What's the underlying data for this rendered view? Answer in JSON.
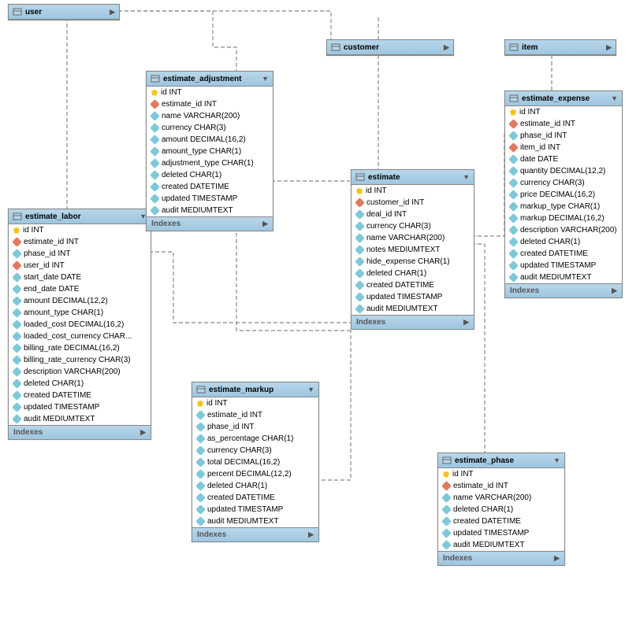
{
  "tables": {
    "user": {
      "title": "user",
      "columns": []
    },
    "customer": {
      "title": "customer",
      "columns": []
    },
    "item": {
      "title": "item",
      "columns": []
    },
    "estimate_labor": {
      "title": "estimate_labor",
      "columns": [
        {
          "kind": "pk",
          "label": "id INT"
        },
        {
          "kind": "fk",
          "label": "estimate_id INT"
        },
        {
          "kind": "fld",
          "label": "phase_id INT"
        },
        {
          "kind": "fk",
          "label": "user_id INT"
        },
        {
          "kind": "fld",
          "label": "start_date DATE"
        },
        {
          "kind": "fld",
          "label": "end_date DATE"
        },
        {
          "kind": "fld",
          "label": "amount DECIMAL(12,2)"
        },
        {
          "kind": "fld",
          "label": "amount_type CHAR(1)"
        },
        {
          "kind": "fld",
          "label": "loaded_cost DECIMAL(16,2)"
        },
        {
          "kind": "fld",
          "label": "loaded_cost_currency CHAR..."
        },
        {
          "kind": "fld",
          "label": "billing_rate DECIMAL(16,2)"
        },
        {
          "kind": "fld",
          "label": "billing_rate_currency CHAR(3)"
        },
        {
          "kind": "fld",
          "label": "description VARCHAR(200)"
        },
        {
          "kind": "fld",
          "label": "deleted CHAR(1)"
        },
        {
          "kind": "fld",
          "label": "created DATETIME"
        },
        {
          "kind": "fld",
          "label": "updated TIMESTAMP"
        },
        {
          "kind": "fld",
          "label": "audit MEDIUMTEXT"
        }
      ],
      "indexes": "Indexes"
    },
    "estimate_adjustment": {
      "title": "estimate_adjustment",
      "columns": [
        {
          "kind": "pk",
          "label": "id INT"
        },
        {
          "kind": "fk",
          "label": "estimate_id INT"
        },
        {
          "kind": "fld",
          "label": "name VARCHAR(200)"
        },
        {
          "kind": "fld",
          "label": "currency CHAR(3)"
        },
        {
          "kind": "fld",
          "label": "amount DECIMAL(16,2)"
        },
        {
          "kind": "fld",
          "label": "amount_type CHAR(1)"
        },
        {
          "kind": "fld",
          "label": "adjustment_type CHAR(1)"
        },
        {
          "kind": "fld",
          "label": "deleted CHAR(1)"
        },
        {
          "kind": "fld",
          "label": "created DATETIME"
        },
        {
          "kind": "fld",
          "label": "updated TIMESTAMP"
        },
        {
          "kind": "fld",
          "label": "audit MEDIUMTEXT"
        }
      ],
      "indexes": "Indexes"
    },
    "estimate": {
      "title": "estimate",
      "columns": [
        {
          "kind": "pk",
          "label": "id INT"
        },
        {
          "kind": "fk",
          "label": "customer_id INT"
        },
        {
          "kind": "fld",
          "label": "deal_id INT"
        },
        {
          "kind": "fld",
          "label": "currency CHAR(3)"
        },
        {
          "kind": "fld",
          "label": "name VARCHAR(200)"
        },
        {
          "kind": "fld",
          "label": "notes MEDIUMTEXT"
        },
        {
          "kind": "fld",
          "label": "hide_expense CHAR(1)"
        },
        {
          "kind": "fld",
          "label": "deleted CHAR(1)"
        },
        {
          "kind": "fld",
          "label": "created DATETIME"
        },
        {
          "kind": "fld",
          "label": "updated TIMESTAMP"
        },
        {
          "kind": "fld",
          "label": "audit MEDIUMTEXT"
        }
      ],
      "indexes": "Indexes"
    },
    "estimate_expense": {
      "title": "estimate_expense",
      "columns": [
        {
          "kind": "pk",
          "label": "id INT"
        },
        {
          "kind": "fk",
          "label": "estimate_id INT"
        },
        {
          "kind": "fld",
          "label": "phase_id INT"
        },
        {
          "kind": "fk",
          "label": "item_id INT"
        },
        {
          "kind": "fld",
          "label": "date DATE"
        },
        {
          "kind": "fld",
          "label": "quantity DECIMAL(12,2)"
        },
        {
          "kind": "fld",
          "label": "currency CHAR(3)"
        },
        {
          "kind": "fld",
          "label": "price DECIMAL(16,2)"
        },
        {
          "kind": "fld",
          "label": "markup_type CHAR(1)"
        },
        {
          "kind": "fld",
          "label": "markup DECIMAL(16,2)"
        },
        {
          "kind": "fld",
          "label": "description VARCHAR(200)"
        },
        {
          "kind": "fld",
          "label": "deleted CHAR(1)"
        },
        {
          "kind": "fld",
          "label": "created DATETIME"
        },
        {
          "kind": "fld",
          "label": "updated TIMESTAMP"
        },
        {
          "kind": "fld",
          "label": "audit MEDIUMTEXT"
        }
      ],
      "indexes": "Indexes"
    },
    "estimate_markup": {
      "title": "estimate_markup",
      "columns": [
        {
          "kind": "pk",
          "label": "id INT"
        },
        {
          "kind": "fld",
          "label": "estimate_id INT"
        },
        {
          "kind": "fld",
          "label": "phase_id INT"
        },
        {
          "kind": "fld",
          "label": "as_percentage CHAR(1)"
        },
        {
          "kind": "fld",
          "label": "currency CHAR(3)"
        },
        {
          "kind": "fld",
          "label": "total DECIMAL(16,2)"
        },
        {
          "kind": "fld",
          "label": "percent DECIMAL(12,2)"
        },
        {
          "kind": "fld",
          "label": "deleted CHAR(1)"
        },
        {
          "kind": "fld",
          "label": "created DATETIME"
        },
        {
          "kind": "fld",
          "label": "updated TIMESTAMP"
        },
        {
          "kind": "fld",
          "label": "audit MEDIUMTEXT"
        }
      ],
      "indexes": "Indexes"
    },
    "estimate_phase": {
      "title": "estimate_phase",
      "columns": [
        {
          "kind": "pk",
          "label": "id INT"
        },
        {
          "kind": "fk",
          "label": "estimate_id INT"
        },
        {
          "kind": "fld",
          "label": "name VARCHAR(200)"
        },
        {
          "kind": "fld",
          "label": "deleted CHAR(1)"
        },
        {
          "kind": "fld",
          "label": "created DATETIME"
        },
        {
          "kind": "fld",
          "label": "updated TIMESTAMP"
        },
        {
          "kind": "fld",
          "label": "audit MEDIUMTEXT"
        }
      ],
      "indexes": "Indexes"
    }
  },
  "chart_data": {
    "type": "er-diagram",
    "entities": [
      "user",
      "customer",
      "item",
      "estimate",
      "estimate_labor",
      "estimate_adjustment",
      "estimate_expense",
      "estimate_markup",
      "estimate_phase"
    ],
    "relationships": [
      {
        "from": "user",
        "to": "estimate_labor",
        "via": "user_id"
      },
      {
        "from": "customer",
        "to": "estimate",
        "via": "customer_id"
      },
      {
        "from": "item",
        "to": "estimate_expense",
        "via": "item_id"
      },
      {
        "from": "estimate",
        "to": "estimate_labor",
        "via": "estimate_id"
      },
      {
        "from": "estimate",
        "to": "estimate_adjustment",
        "via": "estimate_id"
      },
      {
        "from": "estimate",
        "to": "estimate_expense",
        "via": "estimate_id"
      },
      {
        "from": "estimate",
        "to": "estimate_markup",
        "via": "estimate_id"
      },
      {
        "from": "estimate",
        "to": "estimate_phase",
        "via": "estimate_id"
      }
    ]
  }
}
